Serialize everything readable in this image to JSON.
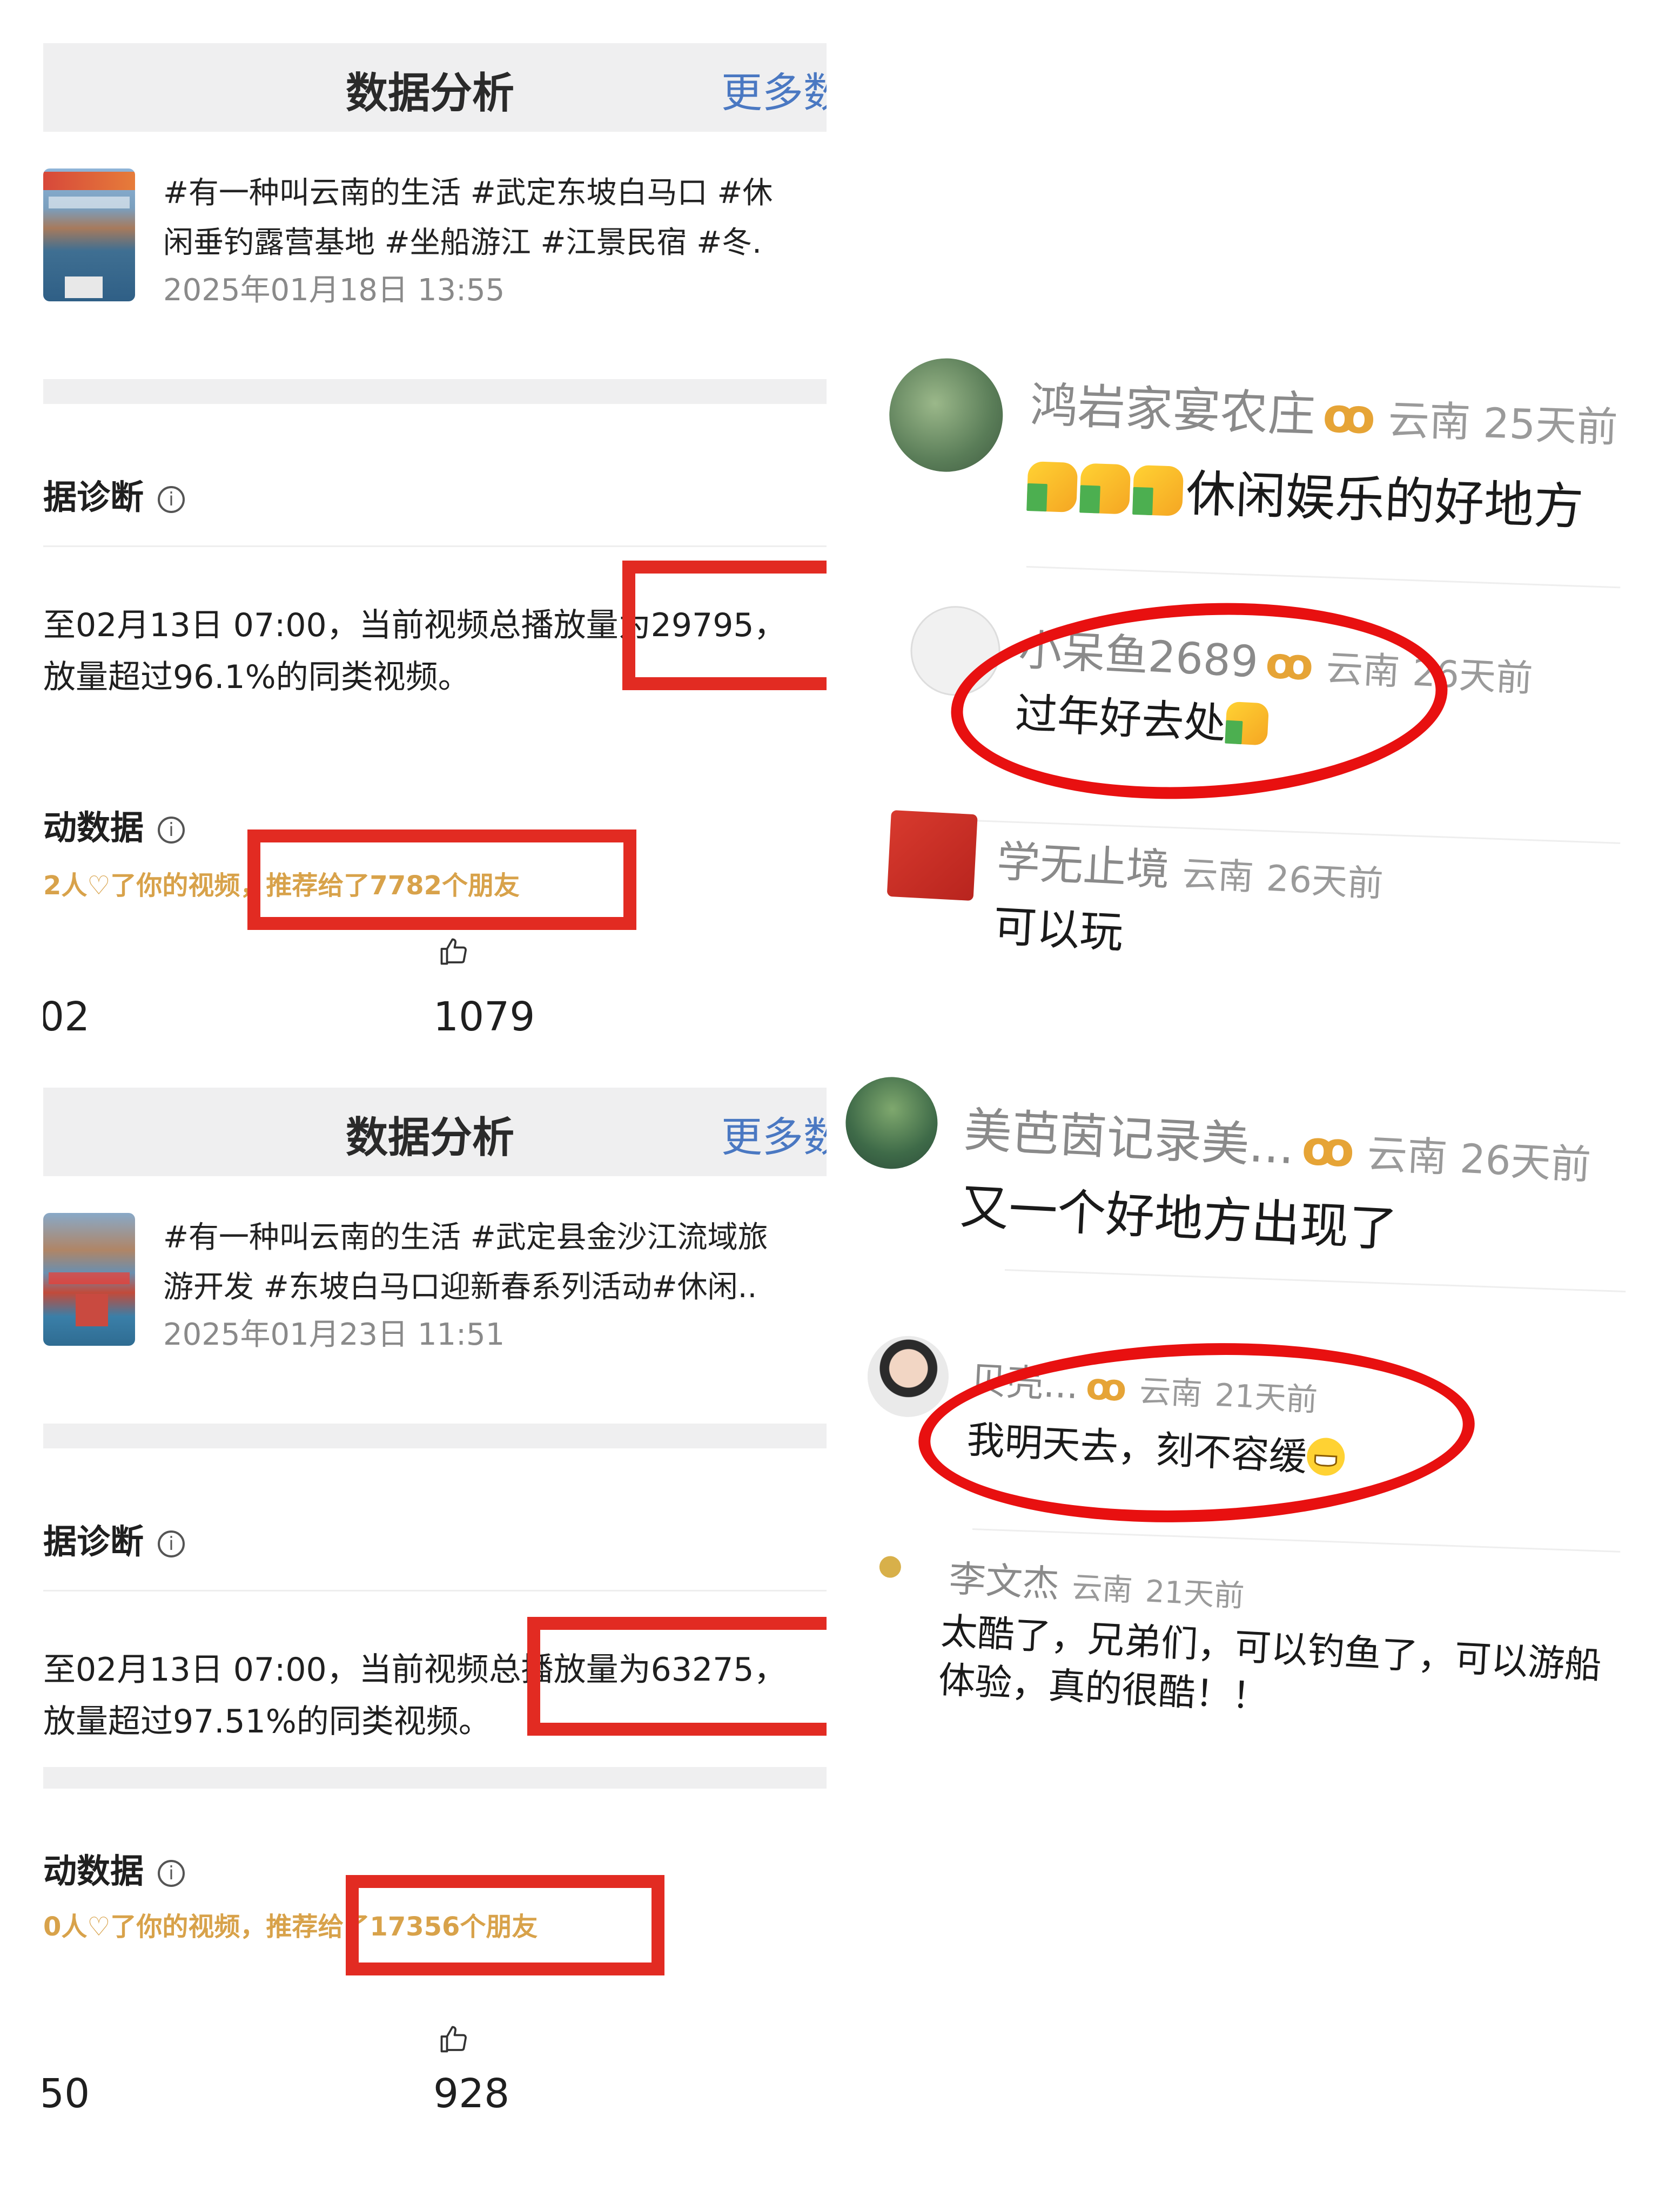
{
  "panels": [
    {
      "header": {
        "title": "数据分析",
        "more": "更多数"
      },
      "video": {
        "title_line1": "#有一种叫云南的生活 #武定东坡白马口 #休",
        "title_line2": "闲垂钓露营基地 #坐船游江 #江景民宿 #冬.",
        "date": "2025年01月18日 13:55"
      },
      "diagnosis": {
        "heading": "据诊断",
        "line1": "至02月13日 07:00，当前视频总播放量为29795，",
        "line2": "放量超过96.1%的同类视频。"
      },
      "interaction": {
        "heading": "动数据",
        "hint": "2人♡了你的视频，推荐给了7782个朋友",
        "left_num": "02",
        "likes": "1079"
      }
    },
    {
      "header": {
        "title": "数据分析",
        "more": "更多数"
      },
      "video": {
        "title_line1": "#有一种叫云南的生活 #武定县金沙江流域旅",
        "title_line2": "游开发 #东坡白马口迎新春系列活动#休闲..",
        "date": "2025年01月23日 11:51"
      },
      "diagnosis": {
        "heading": "据诊断",
        "line1": "至02月13日 07:00，当前视频总播放量为63275，",
        "line2": "放量超过97.51%的同类视频。"
      },
      "interaction": {
        "heading": "动数据",
        "hint": "0人♡了你的视频，推荐给了17356个朋友",
        "left_num": "50",
        "likes": "928"
      }
    }
  ],
  "comments": [
    {
      "user": "鸿岩家宴农庄",
      "badge": "ꝏ",
      "location": "云南",
      "time": "25天前",
      "text": "休闲娱乐的好地方"
    },
    {
      "user": "小呆鱼2689",
      "badge": "ꝏ",
      "location": "云南",
      "time": "26天前",
      "text": "过年好去处"
    },
    {
      "user": "学无止境",
      "location": "云南",
      "time": "26天前",
      "text": "可以玩"
    },
    {
      "user": "美芭茵记录美...",
      "badge": "ꝏ",
      "location": "云南",
      "time": "26天前",
      "text": "又一个好地方出现了"
    },
    {
      "user": "贝壳...",
      "badge": "ꝏ",
      "location": "云南",
      "time": "21天前",
      "text": "我明天去，刻不容缓"
    },
    {
      "user": "李文杰",
      "location": "云南",
      "time": "21天前",
      "text_line1": "太酷了，兄弟们，可以钓鱼了，可以游船",
      "text_line2": "体验，真的很酷！！"
    }
  ],
  "colors": {
    "highlight_red": "#e22b22",
    "link_blue": "#4a78c2",
    "hint_gold": "#d8a24a",
    "badge_gold": "#e6a436"
  },
  "icons": [
    "info-icon",
    "thumbs-up-icon",
    "heart-icon",
    "thumbs-up-emoji",
    "grin-emoji"
  ]
}
